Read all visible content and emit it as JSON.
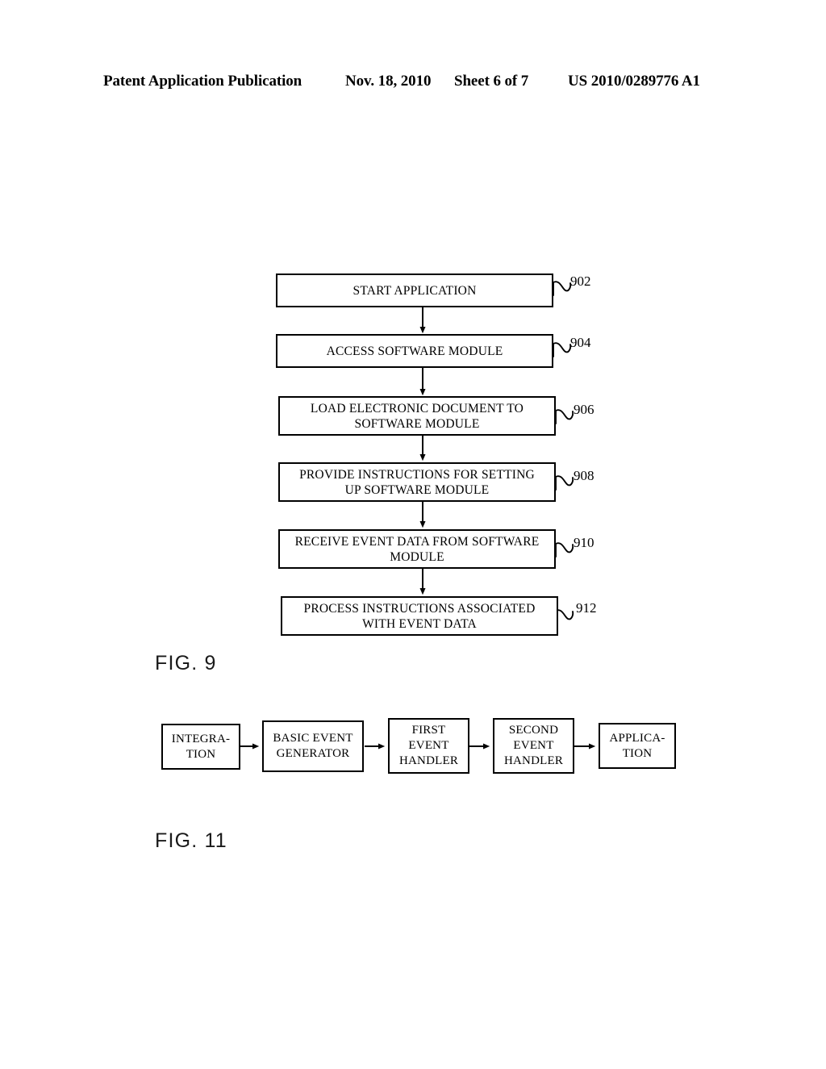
{
  "header": {
    "publication": "Patent Application Publication",
    "date": "Nov. 18, 2010",
    "sheet": "Sheet 6 of 7",
    "patent_number": "US 2010/0289776 A1"
  },
  "figures": [
    {
      "label": "FIG. 9",
      "type": "flowchart",
      "steps": [
        {
          "ref": "902",
          "lines": [
            "START APPLICATION"
          ]
        },
        {
          "ref": "904",
          "lines": [
            "ACCESS SOFTWARE MODULE"
          ]
        },
        {
          "ref": "906",
          "lines": [
            "LOAD ELECTRONIC DOCUMENT TO",
            "SOFTWARE MODULE"
          ]
        },
        {
          "ref": "908",
          "lines": [
            "PROVIDE INSTRUCTIONS FOR SETTING",
            "UP SOFTWARE MODULE"
          ]
        },
        {
          "ref": "910",
          "lines": [
            "RECEIVE EVENT DATA FROM SOFTWARE",
            "MODULE"
          ]
        },
        {
          "ref": "912",
          "lines": [
            "PROCESS INSTRUCTIONS ASSOCIATED",
            "WITH EVENT DATA"
          ]
        }
      ]
    },
    {
      "label": "FIG. 11",
      "type": "block-chain",
      "blocks": [
        {
          "lines": [
            "INTEGRA-",
            "TION"
          ]
        },
        {
          "lines": [
            "BASIC EVENT",
            "GENERATOR"
          ]
        },
        {
          "lines": [
            "FIRST",
            "EVENT",
            "HANDLER"
          ]
        },
        {
          "lines": [
            "SECOND",
            "EVENT",
            "HANDLER"
          ]
        },
        {
          "lines": [
            "APPLICA-",
            "TION"
          ]
        }
      ]
    }
  ],
  "colors": {
    "ink": "#000000",
    "paper": "#ffffff"
  }
}
